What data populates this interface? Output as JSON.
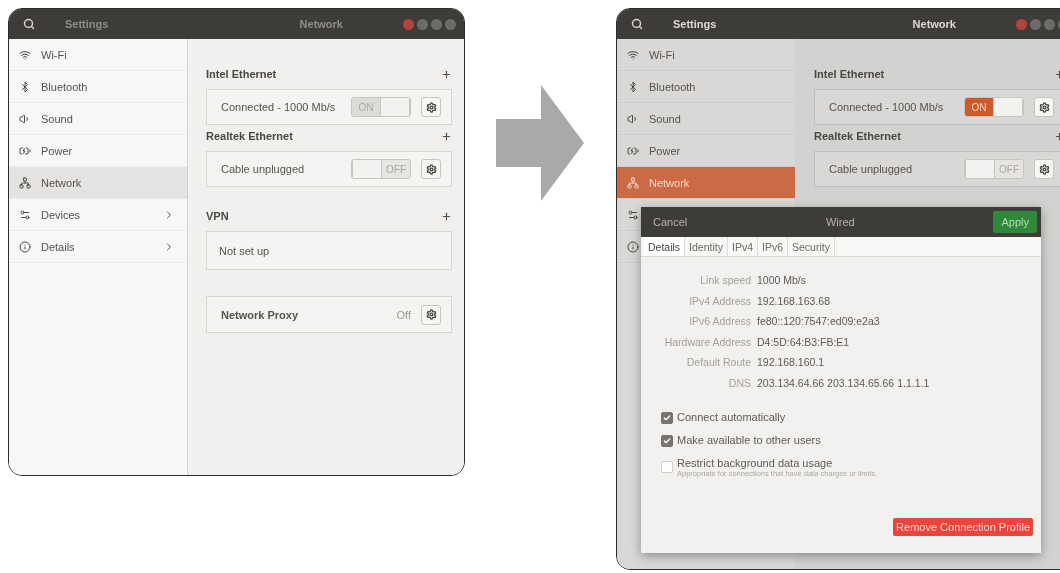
{
  "windows": [
    {
      "focused": false,
      "dimmed": false,
      "sidebar_title": "Settings",
      "panel_title": "Network",
      "sidebar": [
        {
          "kind": "wifi",
          "label": "Wi-Fi",
          "selected": false,
          "chevron": false
        },
        {
          "kind": "bluetooth",
          "label": "Bluetooth",
          "selected": false,
          "chevron": false
        },
        {
          "kind": "sound",
          "label": "Sound",
          "selected": false,
          "chevron": false
        },
        {
          "kind": "power",
          "label": "Power",
          "selected": false,
          "chevron": false
        },
        {
          "kind": "network",
          "label": "Network",
          "selected": true,
          "chevron": false
        },
        {
          "kind": "devices",
          "label": "Devices",
          "selected": false,
          "chevron": true
        },
        {
          "kind": "details",
          "label": "Details",
          "selected": false,
          "chevron": true
        }
      ],
      "sections": [
        {
          "title": "Intel Ethernet",
          "rows": [
            {
              "kind": "connection",
              "text": "Connected - 1000 Mb/s",
              "switch": {
                "on": true,
                "label": "ON"
              }
            }
          ]
        },
        {
          "title": "Realtek Ethernet",
          "rows": [
            {
              "kind": "connection",
              "text": "Cable unplugged",
              "switch": {
                "on": false,
                "label": "OFF"
              }
            }
          ]
        },
        {
          "title": "VPN",
          "rows": [
            {
              "kind": "empty",
              "text": "Not set up"
            }
          ]
        },
        {
          "rows": [
            {
              "kind": "proxy",
              "text": "Network Proxy",
              "status": "Off"
            }
          ]
        }
      ]
    },
    {
      "focused": true,
      "dimmed": true,
      "sidebar_title": "Settings",
      "panel_title": "Network",
      "sidebar": [
        {
          "kind": "wifi",
          "label": "Wi-Fi",
          "selected": false,
          "chevron": false
        },
        {
          "kind": "bluetooth",
          "label": "Bluetooth",
          "selected": false,
          "chevron": false
        },
        {
          "kind": "sound",
          "label": "Sound",
          "selected": false,
          "chevron": false
        },
        {
          "kind": "power",
          "label": "Power",
          "selected": false,
          "chevron": false
        },
        {
          "kind": "network",
          "label": "Network",
          "selected": true,
          "chevron": false
        },
        {
          "kind": "devices",
          "selected": false
        },
        {
          "kind": "details",
          "selected": false
        }
      ],
      "sections": [
        {
          "title": "Intel Ethernet",
          "rows": [
            {
              "kind": "connection",
              "text": "Connected - 1000 Mb/s",
              "switch": {
                "on": true,
                "label": "ON"
              }
            }
          ]
        },
        {
          "title": "Realtek Ethernet",
          "rows": [
            {
              "kind": "connection",
              "text": "Cable unplugged",
              "switch": {
                "on": false,
                "label": "OFF"
              }
            }
          ]
        }
      ],
      "dialog": {
        "cancel": "Cancel",
        "title": "Wired",
        "apply": "Apply",
        "tabs": [
          {
            "label": "Details",
            "selected": true
          },
          {
            "label": "Identity",
            "selected": false
          },
          {
            "label": "IPv4",
            "selected": false
          },
          {
            "label": "IPv6",
            "selected": false
          },
          {
            "label": "Security",
            "selected": false
          }
        ],
        "details": [
          {
            "label": "Link speed",
            "value": "1000 Mb/s"
          },
          {
            "label": "IPv4 Address",
            "value": "192.168.163.68"
          },
          {
            "label": "IPv6 Address",
            "value": "fe80::120:7547:ed09:e2a3"
          },
          {
            "label": "Hardware Address",
            "value": "D4:5D:64:B3:FB:E1"
          },
          {
            "label": "Default Route",
            "value": "192.168.160.1"
          },
          {
            "label": "DNS",
            "value": "203.134.64.66 203.134.65.66 1.1.1.1"
          }
        ],
        "options": [
          {
            "label": "Connect automatically",
            "checked": true
          },
          {
            "label": "Make available to other users",
            "checked": true
          },
          {
            "label": "Restrict background data usage",
            "hint": "Appropriate for connections that have data charges or limits.",
            "checked": false
          }
        ],
        "remove": "Remove Connection Profile"
      }
    }
  ]
}
